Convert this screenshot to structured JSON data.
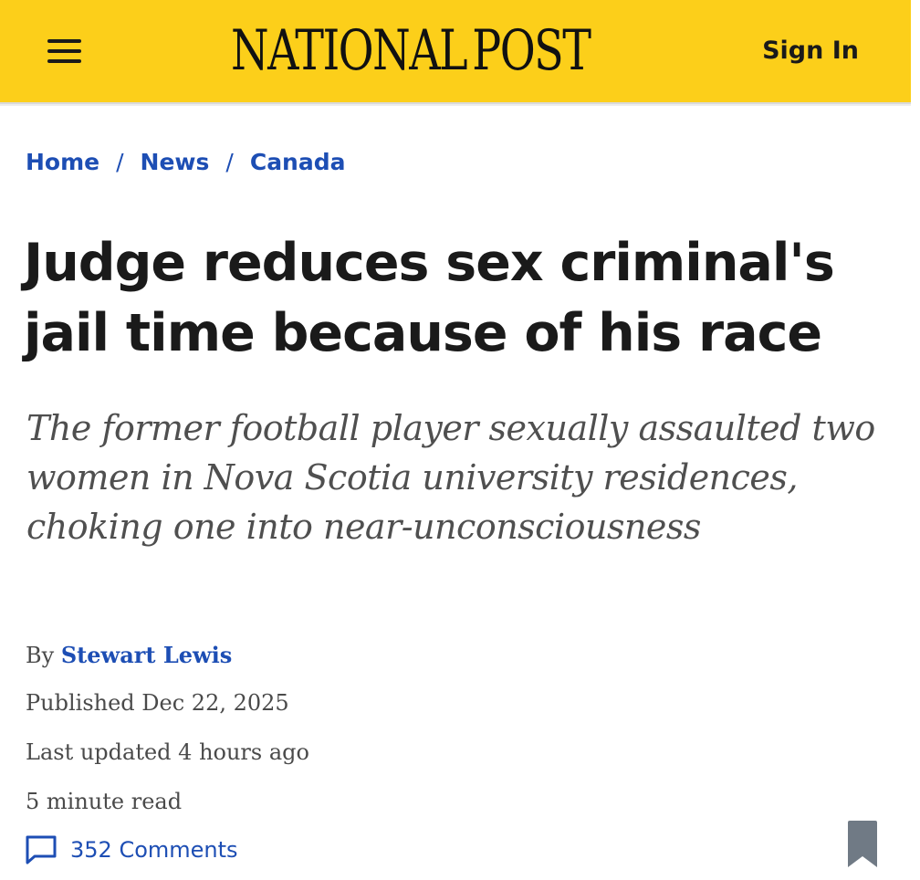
{
  "header": {
    "logo_text_left": "NATIONAL",
    "logo_text_right": "POST",
    "sign_in_label": "Sign In",
    "menu_icon": "hamburger-menu-icon",
    "brand_color": "#fccf1a"
  },
  "breadcrumb": {
    "items": [
      "Home",
      "News",
      "Canada"
    ],
    "separator": "/"
  },
  "article": {
    "headline": "Judge reduces sex criminal's jail time because of his race",
    "deck": "The former football player sexually assaulted two women in Nova Scotia university residences, choking one into near-unconsciousness",
    "byline_prefix": "By",
    "author": "Stewart Lewis",
    "published": "Published Dec 22, 2025",
    "last_updated": "Last updated 4 hours ago",
    "read_time": "5 minute read",
    "comments_label": "352 Comments",
    "comments_icon": "speech-bubble-icon",
    "bookmark_icon": "bookmark-icon",
    "link_color": "#1d4eb4"
  }
}
